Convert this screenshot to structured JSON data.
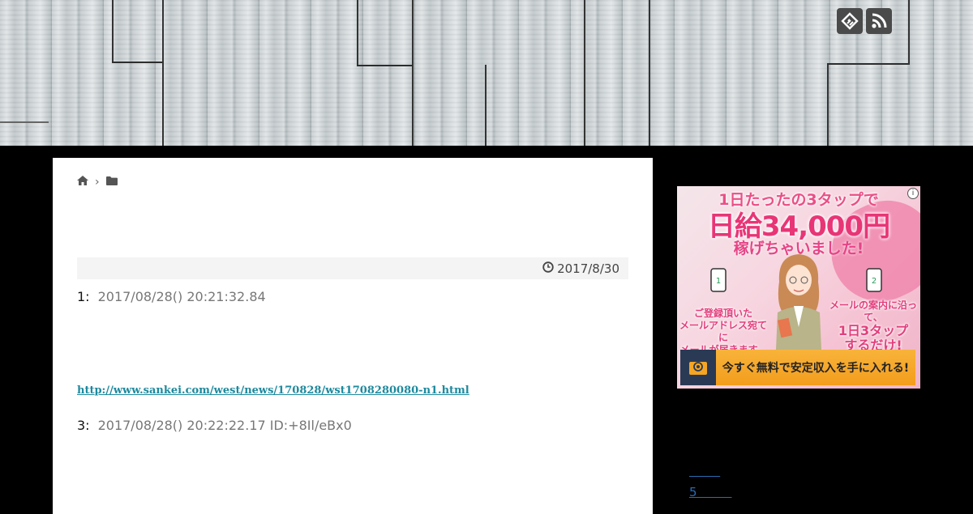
{
  "header": {
    "social": [
      {
        "name": "feedly-icon"
      },
      {
        "name": "rss-icon"
      }
    ]
  },
  "breadcrumb": {
    "home_icon": "home-icon",
    "separator": "›",
    "folder_icon": "folder-icon"
  },
  "post": {
    "date": "2017/8/30",
    "entries": [
      {
        "num": "1:",
        "info": "2017/08/28() 20:21:32.84"
      },
      {
        "num": "3:",
        "info": "2017/08/28() 20:22:22.17 ID:+8Il/eBx0"
      }
    ],
    "link": "http://www.sankei.com/west/news/170828/wst1708280080-n1.html"
  },
  "ad": {
    "line1": "1日たったの3タップで",
    "line2": "日給34,000円",
    "line3": "稼げちゃいました!",
    "left_text": [
      "ご登録頂いた",
      "メールアドレス宛てに",
      "メールが届きます。"
    ],
    "right_text": [
      "メールの案内に沿って、",
      "1日3タップ",
      "するだけ!"
    ],
    "cta": "今すぐ無料で安定収入を手に入れる!",
    "info": "i"
  },
  "sidebar": {
    "links": [
      "        ",
      "5         "
    ]
  }
}
